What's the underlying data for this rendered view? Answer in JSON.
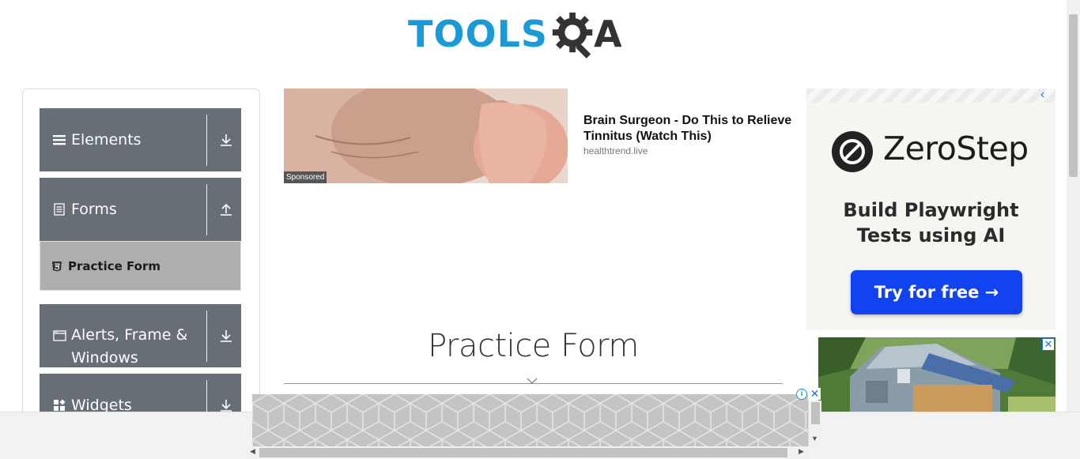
{
  "header": {
    "logo_text_left": "TOOLS",
    "logo_text_right": "A",
    "logo_colors": {
      "tools": "#1a9ad6",
      "qa": "#333333"
    }
  },
  "sidebar": {
    "groups": [
      {
        "label": "Elements",
        "icon": "hamburger-icon",
        "state": "collapsed"
      },
      {
        "label": "Forms",
        "icon": "document-icon",
        "state": "expanded",
        "items": [
          {
            "label": "Practice Form",
            "icon": "html5-icon",
            "active": true
          }
        ]
      },
      {
        "label": "Alerts, Frame & Windows",
        "icon": "window-icon",
        "state": "collapsed"
      },
      {
        "label": "Widgets",
        "icon": "widgets-icon",
        "state": "collapsed"
      }
    ],
    "group_color": "#686e76",
    "active_item_color": "#aeaeae"
  },
  "sponsored_ad": {
    "title": "Brain Surgeon - Do This to Relieve Tinnitus (Watch This)",
    "domain": "healthtrend.live",
    "badge": "Sponsored"
  },
  "right_ad": {
    "brand": "ZeroStep",
    "tagline_line1": "Build Playwright",
    "tagline_line2": "Tests using AI",
    "cta": "Try for free →",
    "cta_color": "#1143f0"
  },
  "main": {
    "page_title": "Practice Form"
  }
}
